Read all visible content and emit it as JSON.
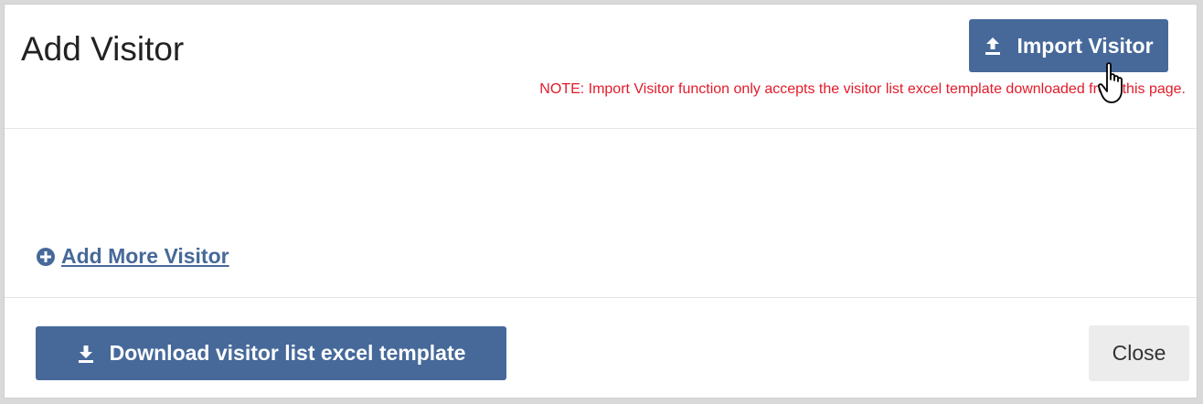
{
  "modal": {
    "title": "Add Visitor",
    "import_button_label": "Import Visitor",
    "note": "NOTE: Import Visitor function only accepts the visitor list excel template downloaded from this page.",
    "add_more_label": "Add More Visitor",
    "download_button_label": "Download visitor list excel template",
    "close_button_label": "Close"
  },
  "icons": {
    "import": "upload-icon",
    "download": "download-icon",
    "add_more": "plus-circle-icon",
    "cursor": "hand-pointer-cursor-icon"
  },
  "colors": {
    "primary": "#46699a",
    "note_text": "#e21b2a",
    "close_bg": "#ececec"
  }
}
